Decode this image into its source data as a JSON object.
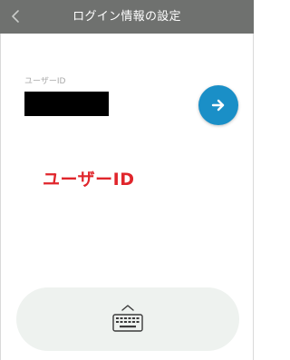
{
  "header": {
    "title": "ログイン情報の設定",
    "back_icon": "chevron-left-icon",
    "background_color": "#6f716f"
  },
  "form": {
    "userid_label": "ユーザーID",
    "userid_value": "",
    "next_icon": "arrow-right-icon",
    "accent_color": "#1a8fc7"
  },
  "annotation": {
    "text": "ユーザーID",
    "color": "#e0252b"
  },
  "keyboard": {
    "icon": "keyboard-icon",
    "toggle_icon": "chevron-up-icon"
  }
}
